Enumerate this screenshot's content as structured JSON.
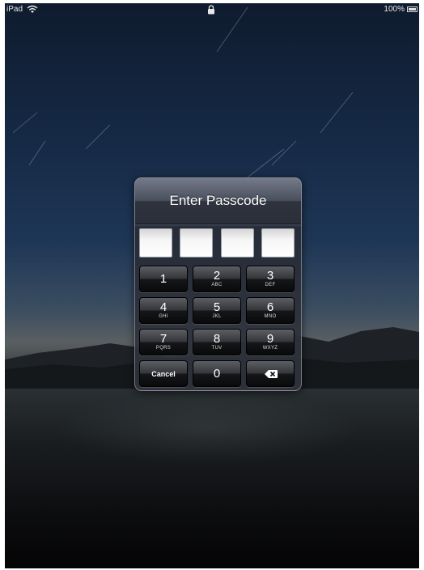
{
  "status_bar": {
    "device": "iPad",
    "battery": "100%"
  },
  "passcode_dialog": {
    "title": "Enter Passcode",
    "keys": [
      {
        "number": "1",
        "letters": ""
      },
      {
        "number": "2",
        "letters": "ABC"
      },
      {
        "number": "3",
        "letters": "DEF"
      },
      {
        "number": "4",
        "letters": "GHI"
      },
      {
        "number": "5",
        "letters": "JKL"
      },
      {
        "number": "6",
        "letters": "MNO"
      },
      {
        "number": "7",
        "letters": "PQRS"
      },
      {
        "number": "8",
        "letters": "TUV"
      },
      {
        "number": "9",
        "letters": "WXYZ"
      }
    ],
    "zero": "0",
    "cancel": "Cancel",
    "delete_icon": "delete-backspace-icon"
  },
  "icons": {
    "wifi": "wifi-icon",
    "lock": "lock-icon",
    "battery": "battery-icon"
  }
}
